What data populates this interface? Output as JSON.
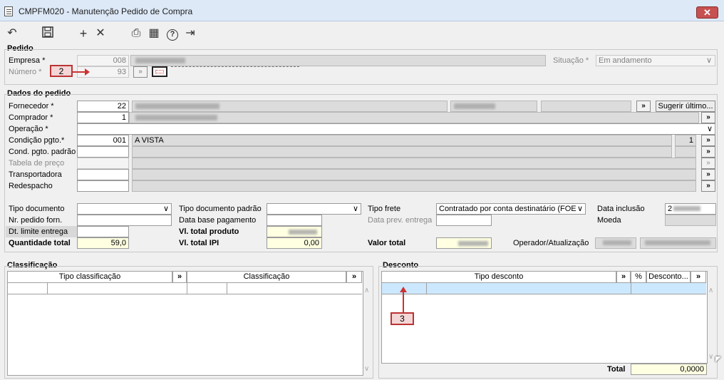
{
  "window": {
    "title": "CMPFM020 - Manutenção Pedido de Compra",
    "close_label": "✕"
  },
  "toolbar": {
    "items": [
      {
        "name": "undo-icon",
        "glyph": "↶"
      },
      {
        "name": "save-icon",
        "glyph": "💾"
      },
      {
        "name": "add-icon",
        "glyph": "+"
      },
      {
        "name": "delete-icon",
        "glyph": "✕"
      },
      {
        "name": "print-icon",
        "glyph": "⎙"
      },
      {
        "name": "calendar-icon",
        "glyph": "▦"
      },
      {
        "name": "help-icon",
        "glyph": "?"
      },
      {
        "name": "exit-icon",
        "glyph": "⇥"
      }
    ]
  },
  "pedido": {
    "section_title": "Pedido",
    "empresa_label": "Empresa *",
    "empresa_value": "008",
    "numero_label": "Número *",
    "numero_value": "93",
    "situacao_label": "Situação *",
    "situacao_value": "Em andamento"
  },
  "dados": {
    "section_title": "Dados do pedido",
    "fornecedor_label": "Fornecedor *",
    "fornecedor_value": "22",
    "comprador_label": "Comprador *",
    "comprador_value": "1",
    "operacao_label": "Operação *",
    "condicao_label": "Condição pgto.*",
    "condicao_value": "001",
    "condicao_desc": "A VISTA",
    "condicao_num": "1",
    "cond_padrao_label": "Cond. pgto. padrão",
    "tabela_label": "Tabela de preço",
    "transportadora_label": "Transportadora",
    "redespacho_label": "Redespacho",
    "sugerir_label": "Sugerir último...",
    "tipo_documento_label": "Tipo documento",
    "tipo_doc_padrao_label": "Tipo documento padrão",
    "tipo_frete_label": "Tipo frete",
    "tipo_frete_value": "Contratado por conta destinatário (FOE",
    "data_inclusao_label": "Data inclusão",
    "data_inclusao_value": "2",
    "nr_pedido_label": "Nr. pedido forn.",
    "data_base_label": "Data base pagamento",
    "data_prev_label": "Data prev. entrega",
    "moeda_label": "Moeda",
    "dt_limite_label": "Dt. limite entrega",
    "vl_total_produto_label": "Vl. total produto",
    "quantidade_label": "Quantidade total",
    "quantidade_value": "59,0",
    "vl_total_ipi_label": "Vl. total IPI",
    "vl_total_ipi_value": "0,00",
    "valor_total_label": "Valor total",
    "operador_label": "Operador/Atualização"
  },
  "classificacao": {
    "section_title": "Classificação",
    "col1": "Tipo classificação",
    "col2": "Classificação"
  },
  "desconto": {
    "section_title": "Desconto",
    "col_tipo": "Tipo desconto",
    "col_pct": "%",
    "col_desc": "Desconto...",
    "total_label": "Total",
    "total_value": "0,0000"
  },
  "annotations": {
    "callout_2": "2",
    "callout_3": "3"
  },
  "common": {
    "lookup_glyph": "»",
    "dropdown_glyph": "∨",
    "lookup_small": "..."
  }
}
